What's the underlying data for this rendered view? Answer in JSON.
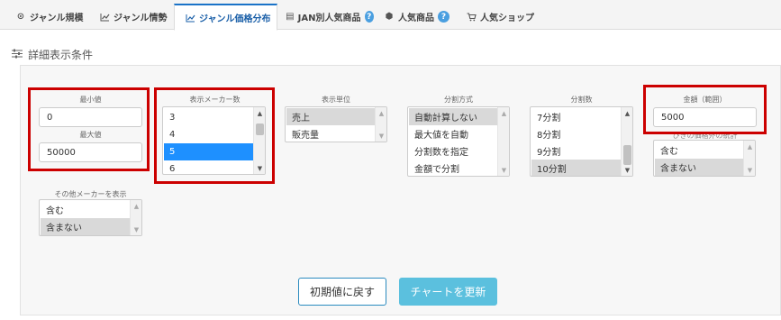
{
  "tabs": [
    {
      "label": "ジャンル規模",
      "icon": "target-icon"
    },
    {
      "label": "ジャンル情勢",
      "icon": "line-chart-icon"
    },
    {
      "label": "ジャンル価格分布",
      "icon": "area-chart-icon",
      "active": true
    },
    {
      "label": "JAN別人気商品",
      "icon": "printer-icon",
      "help": "?"
    },
    {
      "label": "人気商品",
      "icon": "cube-icon",
      "help": "?"
    },
    {
      "label": "人気ショップ",
      "icon": "cart-icon"
    }
  ],
  "section_title": "詳細表示条件",
  "fields": {
    "min_label": "最小値",
    "min_value": "0",
    "max_label": "最大値",
    "max_value": "50000",
    "maker_count_label": "表示メーカー数",
    "maker_count_options": [
      "3",
      "4",
      "5",
      "6"
    ],
    "maker_count_selected": "5",
    "unit_label": "表示単位",
    "unit_options": [
      "売上",
      "販売量"
    ],
    "unit_selected": "売上",
    "split_method_label": "分割方式",
    "split_method_options": [
      "自動計算しない",
      "最大値を自動",
      "分割数を指定",
      "金額で分割"
    ],
    "split_method_selected": "自動計算しない",
    "split_count_label": "分割数",
    "split_count_options": [
      "7分割",
      "8分割",
      "9分割",
      "10分割"
    ],
    "split_count_selected": "10分割",
    "amount_label": "金額（範囲）",
    "amount_value": "5000",
    "other_label_partial": "ひきの価格外の統計",
    "other_options": [
      "含む",
      "含まない"
    ],
    "other_selected": "含まない",
    "other_maker_label": "その他メーカーを表示",
    "other_maker_options": [
      "含む",
      "含まない"
    ],
    "other_maker_selected": "含まない"
  },
  "buttons": {
    "reset": "初期値に戻す",
    "update": "チャートを更新"
  },
  "colors": {
    "highlight_border": "#cc0000",
    "update_button": "#5bc0de",
    "active_tab": "#1a73c8"
  }
}
